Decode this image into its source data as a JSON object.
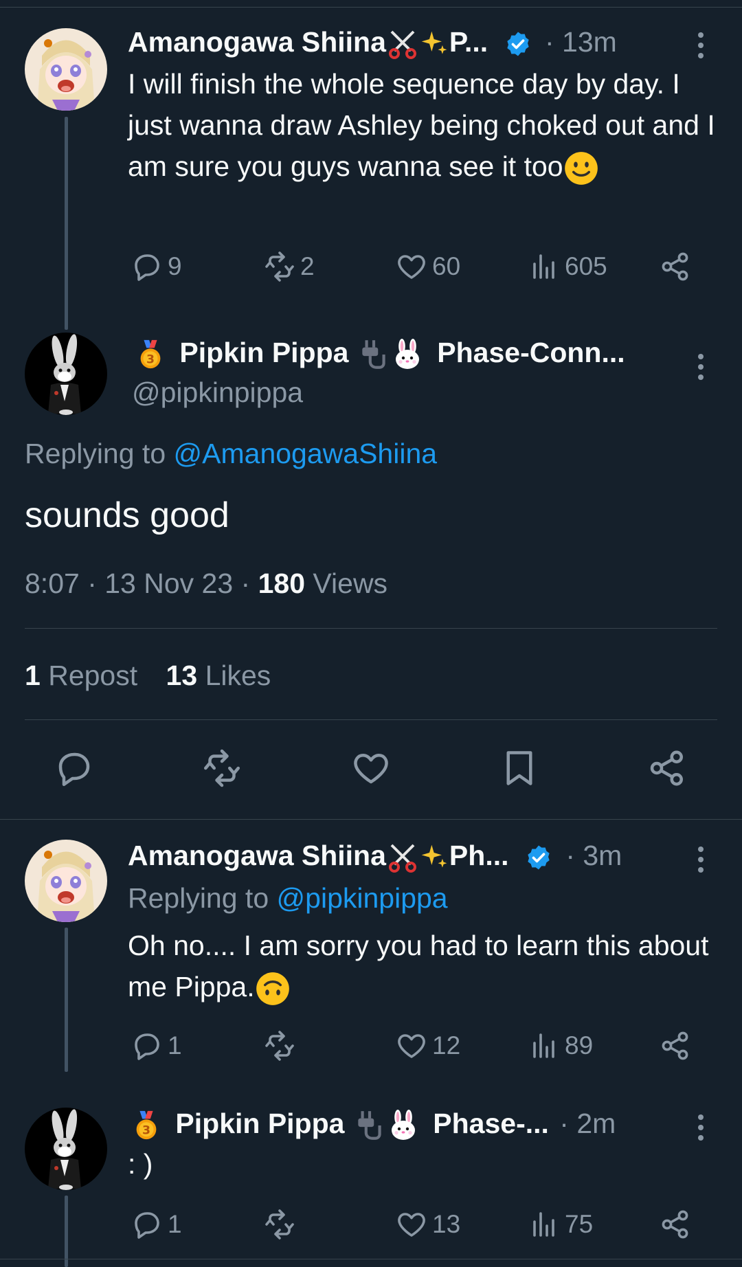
{
  "tweet1": {
    "display_name": "Amanogawa Shiina",
    "name_suffix": "P...",
    "time": "· 13m",
    "text": "I will finish the whole sequence day by day. I just wanna draw Ashley being choked out and I am sure you guys wanna see it too",
    "replies": "9",
    "reposts": "2",
    "likes": "60",
    "views": "605"
  },
  "main_tweet": {
    "display_name": "Pipkin Pippa",
    "name_suffix": "Phase-Conn...",
    "handle": "@pipkinpippa",
    "replying_to_label": "Replying to",
    "replying_to_handle": "@AmanogawaShiina",
    "text": "sounds good",
    "timestamp": "8:07 · 13 Nov 23 ·",
    "views_count": "180",
    "views_label": "Views",
    "repost_count": "1",
    "repost_label": "Repost",
    "likes_count": "13",
    "likes_label": "Likes"
  },
  "tweet3": {
    "display_name": "Amanogawa Shiina",
    "name_suffix": "Ph...",
    "time": "· 3m",
    "replying_to_label": "Replying to",
    "replying_to_handle": "@pipkinpippa",
    "text": "Oh no.... I am sorry you had to learn this about me Pippa.",
    "replies": "1",
    "reposts": "",
    "likes": "12",
    "views": "89"
  },
  "tweet4": {
    "display_name": "Pipkin Pippa",
    "name_suffix": "Phase-...",
    "time": "· 2m",
    "text": ": )",
    "replies": "1",
    "reposts": "",
    "likes": "13",
    "views": "75"
  },
  "colors": {
    "background": "#15202b",
    "muted": "#8b98a5",
    "link": "#1d9bf0",
    "divider": "#38444d"
  }
}
